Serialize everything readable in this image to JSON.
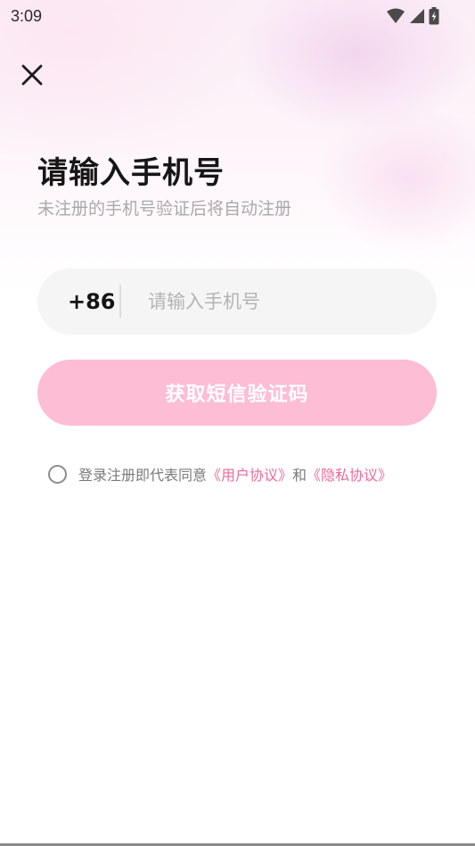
{
  "status_bar": {
    "time": "3:09",
    "icons": [
      "wifi-icon",
      "cellular-signal-icon",
      "battery-charging-icon"
    ]
  },
  "header": {
    "close_icon": "close-icon"
  },
  "main": {
    "title": "请输入手机号",
    "subtitle": "未注册的手机号验证后将自动注册",
    "phone": {
      "country_code": "+86",
      "placeholder": "请输入手机号",
      "value": ""
    },
    "sms_button_label": "获取短信验证码",
    "agreement": {
      "checked": false,
      "prefix": "登录注册即代表同意",
      "user_agreement": "《用户协议》",
      "conjunction": "和",
      "privacy_policy": "《隐私协议》"
    }
  },
  "colors": {
    "accent": "#ec6a9a",
    "button_disabled": "#fdbdd4",
    "input_background": "#f5f5f5"
  }
}
